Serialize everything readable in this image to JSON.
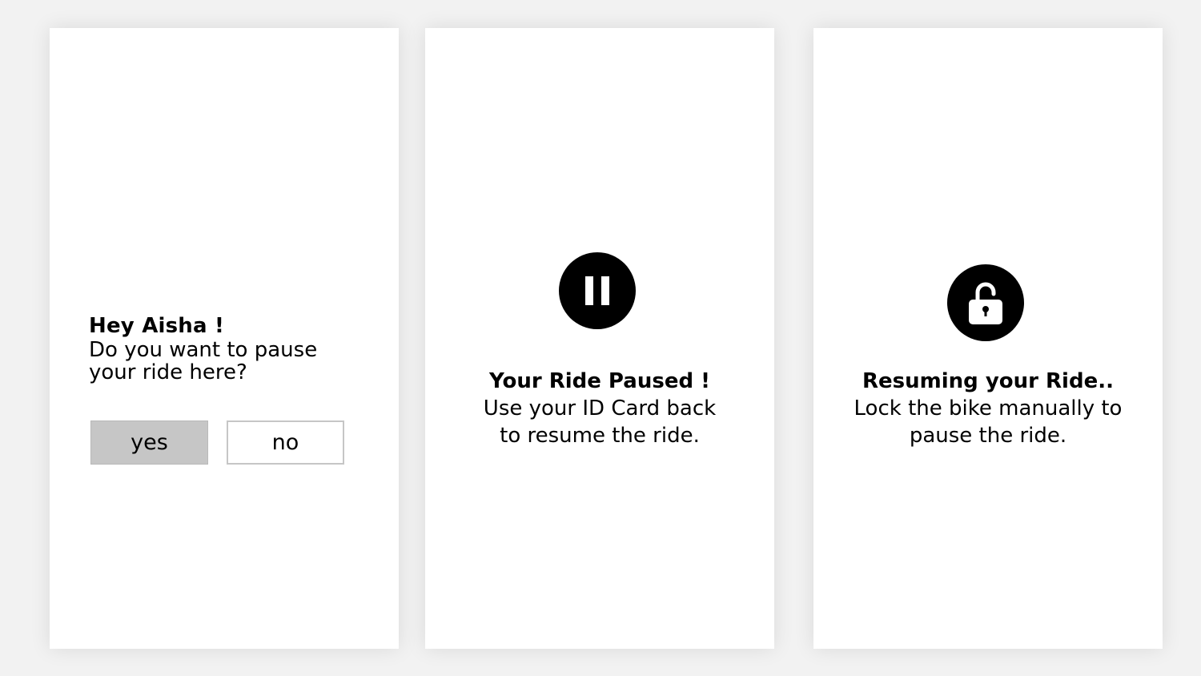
{
  "screens": [
    {
      "title": "Hey Aisha !",
      "question_line1": "Do you want to pause",
      "question_line2": "your ride here?",
      "buttons": {
        "yes": "yes",
        "no": "no"
      }
    },
    {
      "icon": "pause-icon",
      "title": "Your Ride Paused !",
      "body_line1": "Use your ID Card back",
      "body_line2": "to resume the ride."
    },
    {
      "icon": "unlock-icon",
      "title": "Resuming your Ride..",
      "body_line1": "Lock the bike manually to",
      "body_line2": "pause the ride."
    }
  ],
  "colors": {
    "background": "#f2f2f2",
    "card": "#ffffff",
    "icon": "#000000",
    "yes_button": "#c6c6c6",
    "no_button_border": "#c6c6c6"
  }
}
